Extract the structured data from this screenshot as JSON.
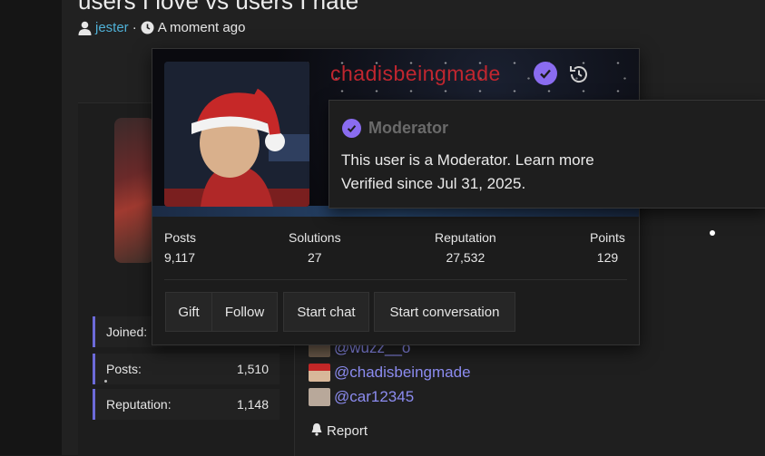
{
  "thread": {
    "title": "users I love vs users I hate"
  },
  "byline": {
    "username": "jester",
    "separator": "·",
    "time": "A moment ago"
  },
  "profile_card": {
    "username": "chadisbeingmade",
    "stats": [
      {
        "label": "Posts",
        "value": "9,117"
      },
      {
        "label": "Solutions",
        "value": "27"
      },
      {
        "label": "Reputation",
        "value": "27,532"
      },
      {
        "label": "Points",
        "value": "129"
      }
    ],
    "buttons": {
      "gift": "Gift",
      "follow": "Follow",
      "start_chat": "Start chat",
      "start_conversation": "Start conversation"
    }
  },
  "tooltip": {
    "role": "Moderator",
    "line1": "This user is a Moderator. Learn more",
    "line2": "Verified since Jul 31, 2025."
  },
  "author_stats": [
    {
      "label": "Joined:",
      "value": ""
    },
    {
      "label": "Posts:",
      "value": "1,510"
    },
    {
      "label": "Reputation:",
      "value": "1,148"
    }
  ],
  "mentions": [
    "@wuzz__o",
    "@chadisbeingmade",
    "@car12345"
  ],
  "actions": {
    "report": "Report"
  },
  "colors": {
    "accent": "#8a6cf0",
    "username_red": "#c0262f",
    "link_blue": "#8c8cf0",
    "byline_link": "#4fb0d6"
  },
  "icons": {
    "user": "user-icon",
    "clock": "clock-icon",
    "verified": "verified-check-icon",
    "history": "history-icon",
    "report": "bell-icon"
  }
}
